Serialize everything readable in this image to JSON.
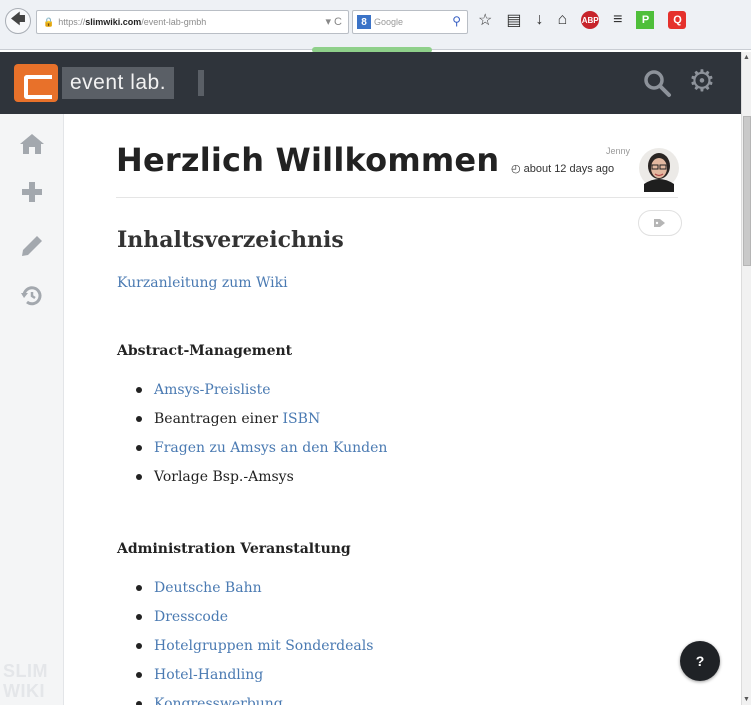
{
  "browser": {
    "url_protocol": "https://",
    "url_host": "slimwiki.com",
    "url_path": "/event-lab-gmbh",
    "search_engine_badge": "8",
    "search_placeholder": "Google",
    "adblock_badge": "ABP",
    "addon_green": "P",
    "addon_red": "Q"
  },
  "app": {
    "logo_text": "event lab."
  },
  "sidebar": {
    "brand_line1": "SLIM",
    "brand_line2": "WIKI"
  },
  "page": {
    "title": "Herzlich Willkommen",
    "author": "Jenny",
    "timestamp": "about 12 days ago",
    "toc_heading": "Inhaltsverzeichnis",
    "intro_link": "Kurzanleitung zum Wiki",
    "sections": [
      {
        "heading": "Abstract-Management",
        "items": [
          {
            "prefix": "",
            "link": "Amsys-Preisliste"
          },
          {
            "prefix": "Beantragen einer ",
            "link": "ISBN"
          },
          {
            "prefix": "",
            "link": "Fragen zu Amsys an den Kunden"
          },
          {
            "prefix": "Vorlage Bsp.-Amsys",
            "link": ""
          }
        ]
      },
      {
        "heading": "Administration Veranstaltung",
        "items": [
          {
            "prefix": "",
            "link": "Deutsche Bahn"
          },
          {
            "prefix": "",
            "link": "Dresscode"
          },
          {
            "prefix": "",
            "link": "Hotelgruppen mit Sonderdeals"
          },
          {
            "prefix": "",
            "link": "Hotel-Handling"
          },
          {
            "prefix": "",
            "link": "Kongresswerbung"
          }
        ]
      }
    ]
  },
  "help_button_label": "?",
  "colors": {
    "header_bg": "#2f343b",
    "logo_orange": "#e8712a",
    "link_blue": "#4a7ab2",
    "sidebar_icon": "#a3a8ae"
  }
}
